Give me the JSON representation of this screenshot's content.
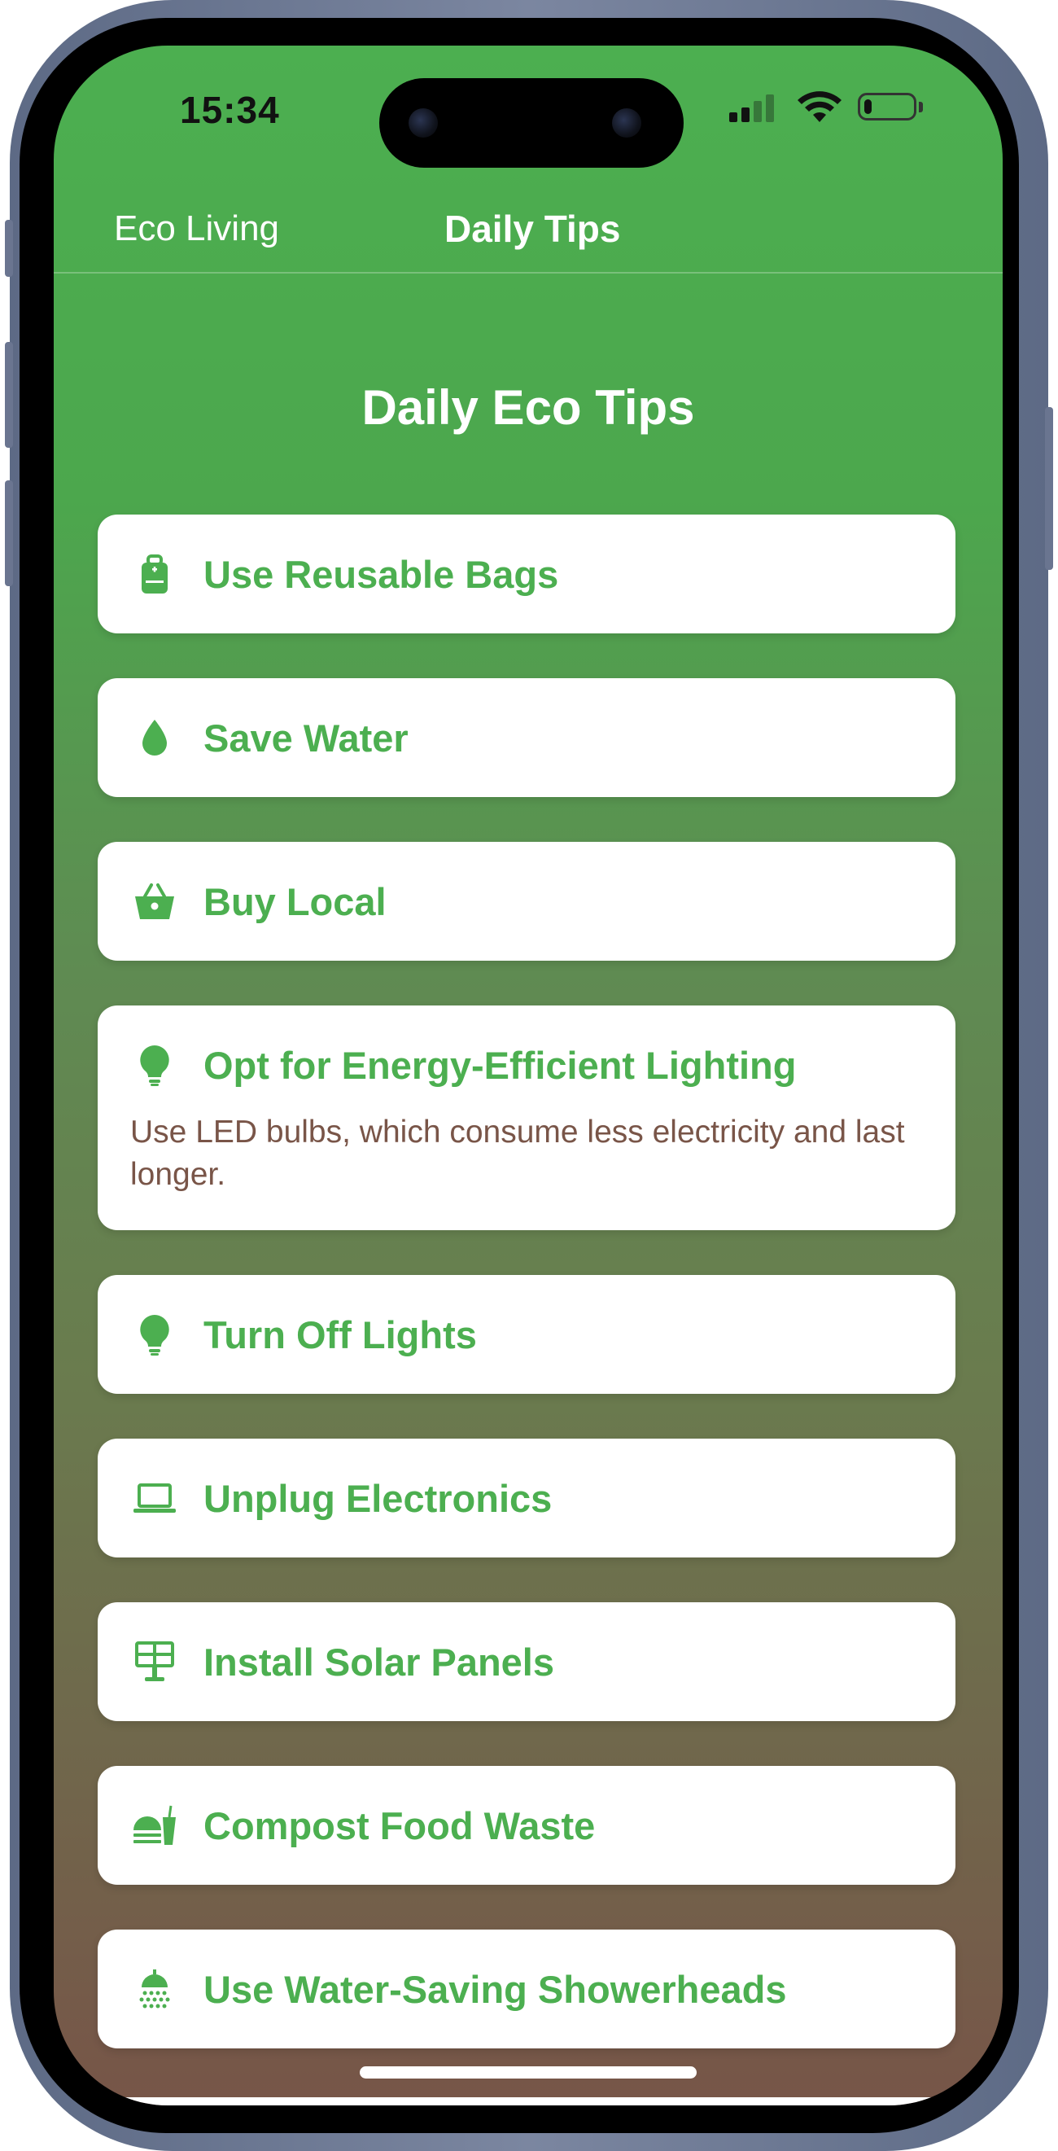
{
  "status_bar": {
    "time": "15:34",
    "signal_icon": "cellular-signal-icon",
    "wifi_icon": "wifi-icon",
    "battery_icon": "battery-icon",
    "battery_level": 0.15
  },
  "nav": {
    "back_label": "Eco Living",
    "title": "Daily Tips"
  },
  "page": {
    "heading": "Daily Eco Tips"
  },
  "colors": {
    "accent_green": "#4caf50",
    "desc_brown": "#795548",
    "gradient_top": "#4caf50",
    "gradient_bottom": "#775548"
  },
  "tips": [
    {
      "title": "Use Reusable Bags",
      "icon": "backpack-icon",
      "expanded": false
    },
    {
      "title": "Save Water",
      "icon": "water-drop-icon",
      "expanded": false
    },
    {
      "title": "Buy Local",
      "icon": "shopping-basket-icon",
      "expanded": false
    },
    {
      "title": "Opt for Energy-Efficient Lighting",
      "icon": "lightbulb-icon",
      "expanded": true,
      "description": "Use LED bulbs, which consume less electricity and last longer."
    },
    {
      "title": "Turn Off Lights",
      "icon": "lightbulb-icon",
      "expanded": false
    },
    {
      "title": "Unplug Electronics",
      "icon": "laptop-icon",
      "expanded": false
    },
    {
      "title": "Install Solar Panels",
      "icon": "solar-panel-icon",
      "expanded": false
    },
    {
      "title": "Compost Food Waste",
      "icon": "food-waste-icon",
      "expanded": false
    },
    {
      "title": "Use Water-Saving Showerheads",
      "icon": "shower-icon",
      "expanded": false
    }
  ]
}
